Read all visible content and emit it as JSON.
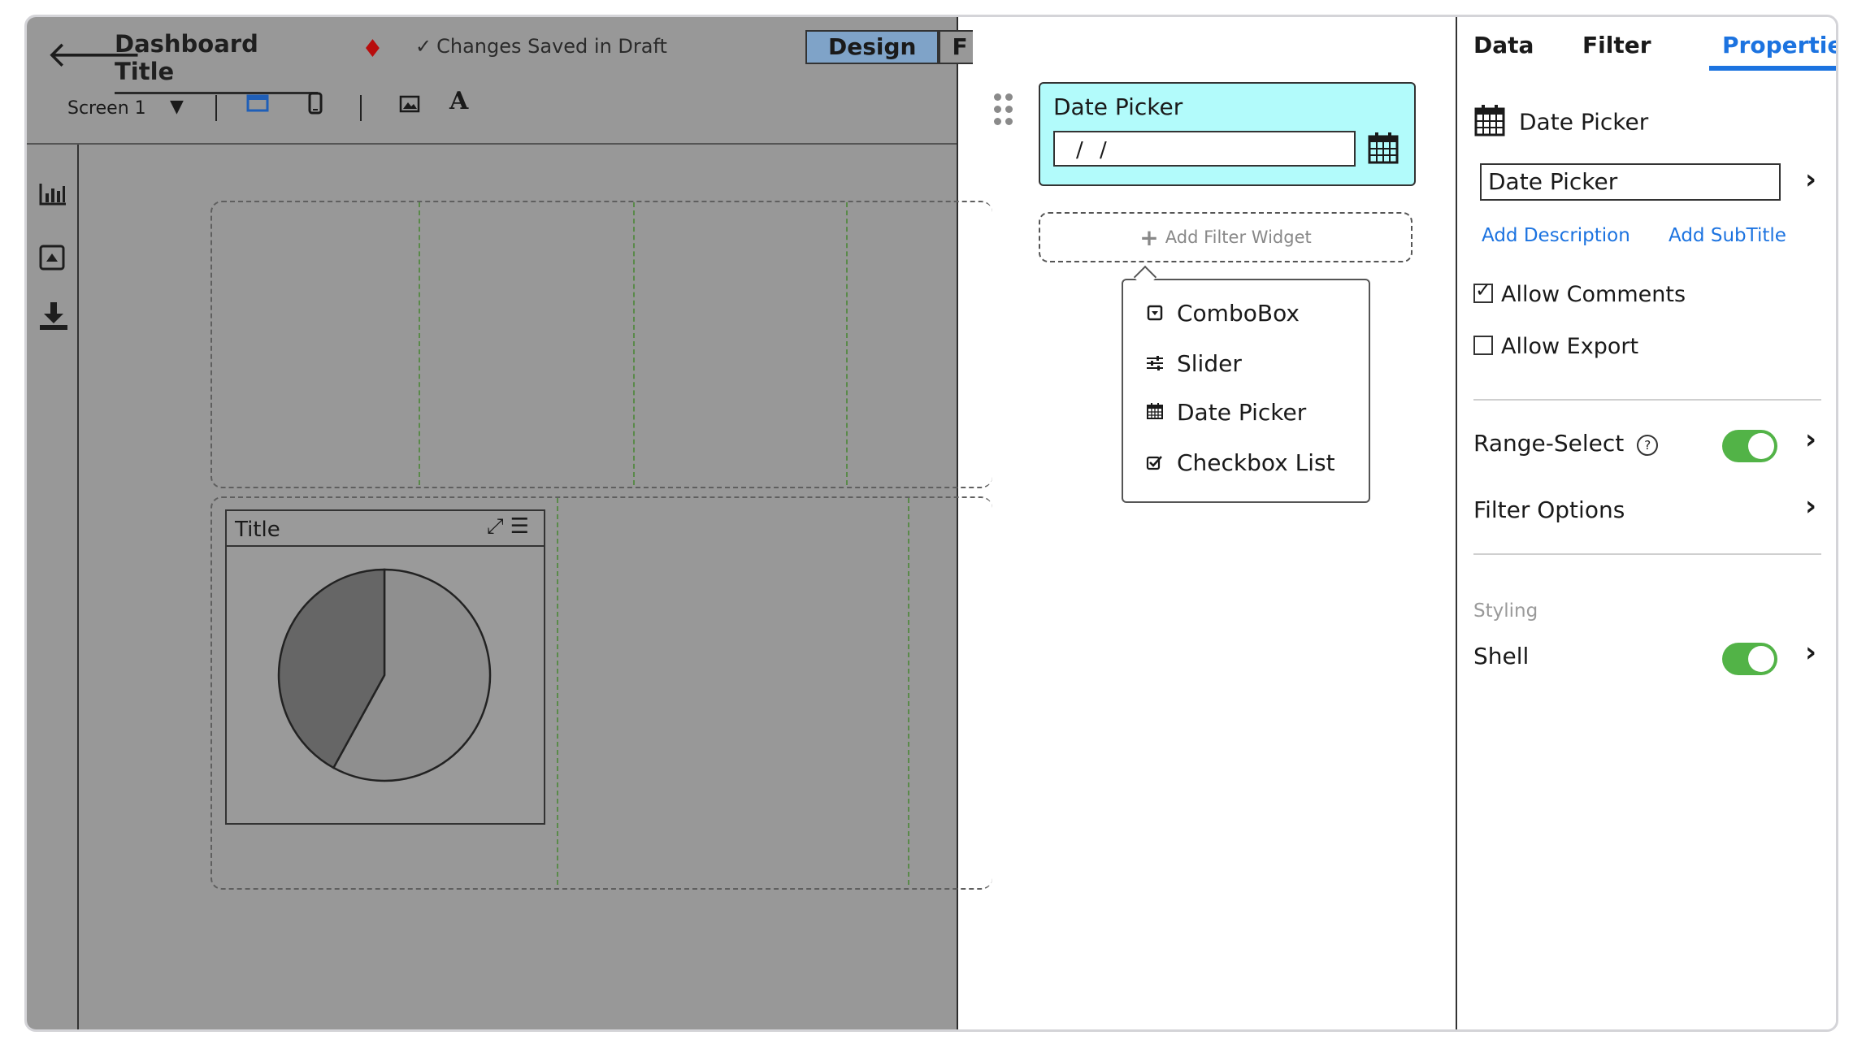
{
  "header": {
    "title": "Dashboard Title",
    "save_status": "Changes Saved in Draft",
    "mode_tabs": [
      "Design",
      "F"
    ],
    "screen_selector": "Screen 1"
  },
  "icons": {
    "back": "arrow-left-icon",
    "tag": "tag-icon",
    "saved": "check-icon",
    "toolbar": [
      "desktop-icon",
      "mobile-icon",
      "image-icon",
      "text-icon"
    ],
    "rail": [
      "chart-icon",
      "widget-icon",
      "download-icon"
    ]
  },
  "widget": {
    "title": "Title",
    "chart_data": {
      "type": "pie",
      "values": [
        58,
        42
      ]
    }
  },
  "filter_area": {
    "date_picker": {
      "title": "Date Picker",
      "input_value": "/ /"
    },
    "add_filter_label": "Add Filter Widget",
    "menu_items": [
      {
        "label": "ComboBox",
        "icon": "combobox-icon"
      },
      {
        "label": "Slider",
        "icon": "slider-icon"
      },
      {
        "label": "Date Picker",
        "icon": "calendar-icon"
      },
      {
        "label": "Checkbox List",
        "icon": "checkbox-icon"
      }
    ]
  },
  "panel": {
    "tabs": [
      "Data",
      "Filter",
      "Properties"
    ],
    "active_tab": "Properties",
    "header_title": "Date Picker",
    "name_value": "Date Picker",
    "links": [
      "Add Description",
      "Add SubTitle"
    ],
    "allow_comments": {
      "label": "Allow Comments",
      "checked": true
    },
    "allow_export": {
      "label": "Allow Export",
      "checked": false
    },
    "range_select": {
      "label": "Range-Select",
      "on": true
    },
    "filter_options": "Filter Options",
    "styling_section": "Styling",
    "shell": {
      "label": "Shell",
      "on": true
    },
    "accent_color": "#1c73e0",
    "toggle_color": "#52b347"
  }
}
